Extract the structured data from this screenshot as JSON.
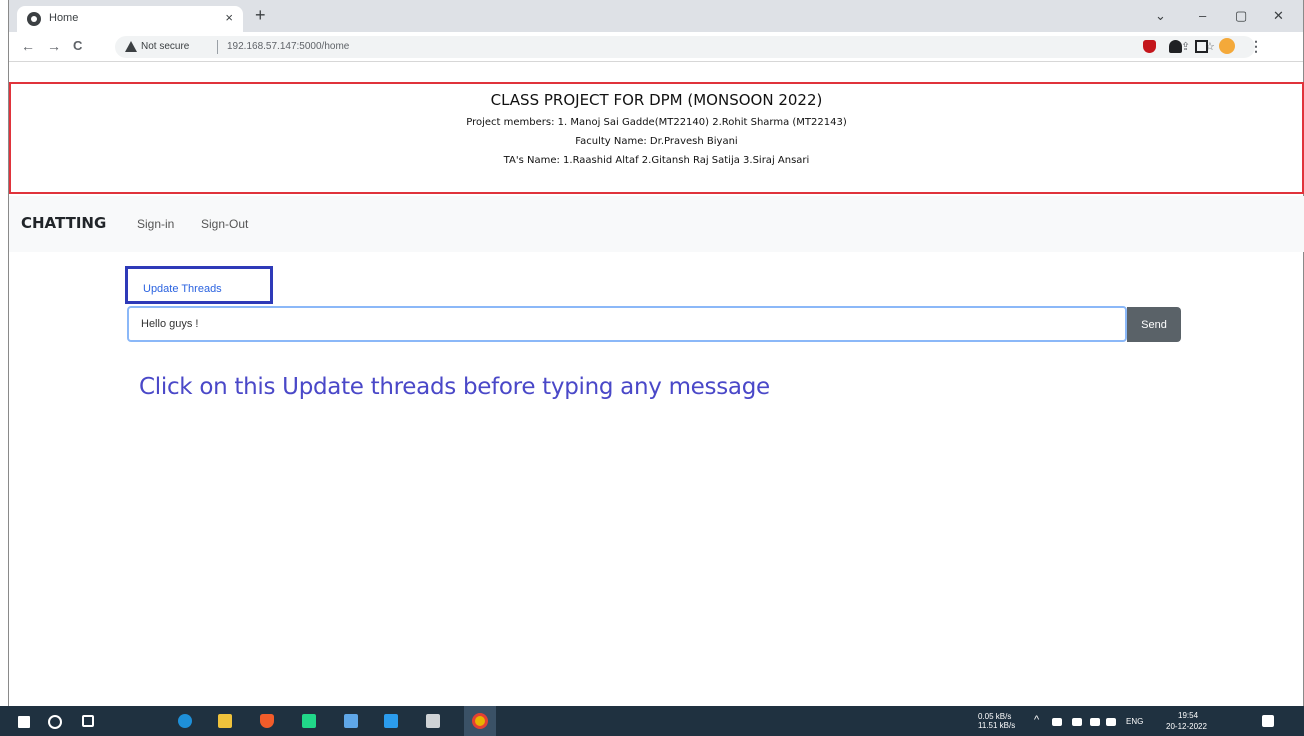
{
  "browser": {
    "tab_title": "Home",
    "tab_close": "×",
    "new_tab": "+",
    "security_label": "Not secure",
    "url": "192.168.57.147:5000/home",
    "window_buttons": [
      "⌄",
      "–",
      "▢",
      "✕"
    ],
    "nav": {
      "back": "←",
      "forward": "→",
      "reload": "C"
    },
    "toolbar_right": [
      "⇪",
      "☆",
      "⋮"
    ]
  },
  "banner": {
    "title": "CLASS PROJECT FOR DPM (MONSOON 2022)",
    "members": "Project members: 1. Manoj Sai Gadde(MT22140) 2.Rohit Sharma (MT22143)",
    "faculty": "Faculty Name: Dr.Pravesh Biyani",
    "tas": "TA's Name: 1.Raashid Altaf 2.Gitansh Raj Satija 3.Siraj Ansari",
    "border_color": "#e0333b"
  },
  "navbar": {
    "brand": "CHATTING",
    "links": [
      "Sign-in",
      "Sign-Out"
    ]
  },
  "chat": {
    "update_threads": "Update Threads",
    "message_value": "Hello guys !",
    "send": "Send",
    "annotation": "Click on this Update threads before typing any message",
    "annotation_color": "#4a48c8"
  },
  "taskbar": {
    "net_up": "0.05 kB/s",
    "net_down": "11.51 kB/s",
    "lang": "ENG",
    "time": "19:54",
    "date": "20-12-2022"
  }
}
